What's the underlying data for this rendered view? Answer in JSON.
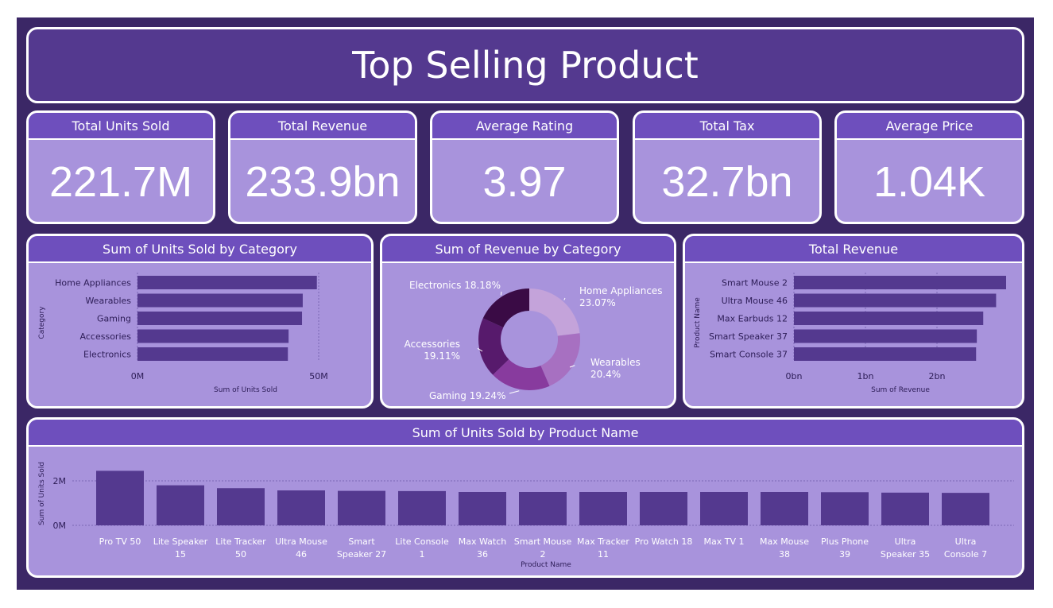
{
  "title": "Top Selling Product",
  "colors": {
    "bar": "#54398f",
    "card": "#a893dc",
    "header": "#6e4fbd",
    "background": "#3b2766"
  },
  "kpis": [
    {
      "label": "Total Units Sold",
      "value": "221.7M"
    },
    {
      "label": "Total Revenue",
      "value": "233.9bn"
    },
    {
      "label": "Average Rating",
      "value": "3.97"
    },
    {
      "label": "Total Tax",
      "value": "32.7bn"
    },
    {
      "label": "Average Price",
      "value": "1.04K"
    }
  ],
  "chart_data": [
    {
      "type": "bar",
      "orientation": "horizontal",
      "title": "Sum of Units Sold by Category",
      "xlabel": "Sum of Units Sold",
      "ylabel": "Category",
      "categories": [
        "Home Appliances",
        "Wearables",
        "Gaming",
        "Accessories",
        "Electronics"
      ],
      "values": [
        49.5,
        45.6,
        45.4,
        41.7,
        41.5
      ],
      "unit": "M",
      "xlim": [
        0,
        50
      ],
      "xticks": [
        "0M",
        "50M"
      ],
      "grid": true
    },
    {
      "type": "pie",
      "donut": true,
      "title": "Sum of Revenue by Category",
      "slices": [
        {
          "label": "Home Appliances",
          "value": 23.07,
          "text": "Home Appliances 23.07%",
          "color": "#c4a3da"
        },
        {
          "label": "Wearables",
          "value": 20.4,
          "text": "Wearables 20.4%",
          "color": "#a770c1"
        },
        {
          "label": "Gaming",
          "value": 19.24,
          "text": "Gaming 19.24%",
          "color": "#883b9e"
        },
        {
          "label": "Accessories",
          "value": 19.11,
          "text": "Accessories 19.11%",
          "color": "#571a6c"
        },
        {
          "label": "Electronics",
          "value": 18.18,
          "text": "Electronics 18.18%",
          "color": "#3a0b45"
        }
      ]
    },
    {
      "type": "bar",
      "orientation": "horizontal",
      "title": "Total Revenue",
      "xlabel": "Sum of Revenue",
      "ylabel": "Product Name",
      "categories": [
        "Smart Mouse 2",
        "Ultra Mouse 46",
        "Max Earbuds 12",
        "Smart Speaker 37",
        "Smart Console 37"
      ],
      "values": [
        2.97,
        2.83,
        2.65,
        2.56,
        2.55
      ],
      "unit": "bn",
      "xlim": [
        0,
        2.97
      ],
      "xticks": [
        "0bn",
        "1bn",
        "2bn"
      ],
      "grid": true
    },
    {
      "type": "bar",
      "orientation": "vertical",
      "title": "Sum of Units Sold by Product Name",
      "xlabel": "Product Name",
      "ylabel": "Sum of Units Sold",
      "categories": [
        [
          "Pro TV 50"
        ],
        [
          "Lite Speaker",
          "15"
        ],
        [
          "Lite Tracker",
          "50"
        ],
        [
          "Ultra Mouse",
          "46"
        ],
        [
          "Smart",
          "Speaker 27"
        ],
        [
          "Lite Console",
          "1"
        ],
        [
          "Max Watch",
          "36"
        ],
        [
          "Smart Mouse",
          "2"
        ],
        [
          "Max Tracker",
          "11"
        ],
        [
          "Pro Watch 18"
        ],
        [
          "Max TV 1"
        ],
        [
          "Max Mouse",
          "38"
        ],
        [
          "Plus Phone",
          "39"
        ],
        [
          "Ultra",
          "Speaker 35"
        ],
        [
          "Ultra",
          "Console 7"
        ]
      ],
      "values": [
        2.45,
        1.8,
        1.67,
        1.57,
        1.55,
        1.54,
        1.5,
        1.5,
        1.5,
        1.5,
        1.5,
        1.5,
        1.49,
        1.47,
        1.46
      ],
      "unit": "M",
      "ylim": [
        0,
        2.5
      ],
      "yticks": [
        "0M",
        "2M"
      ],
      "grid": true
    }
  ]
}
